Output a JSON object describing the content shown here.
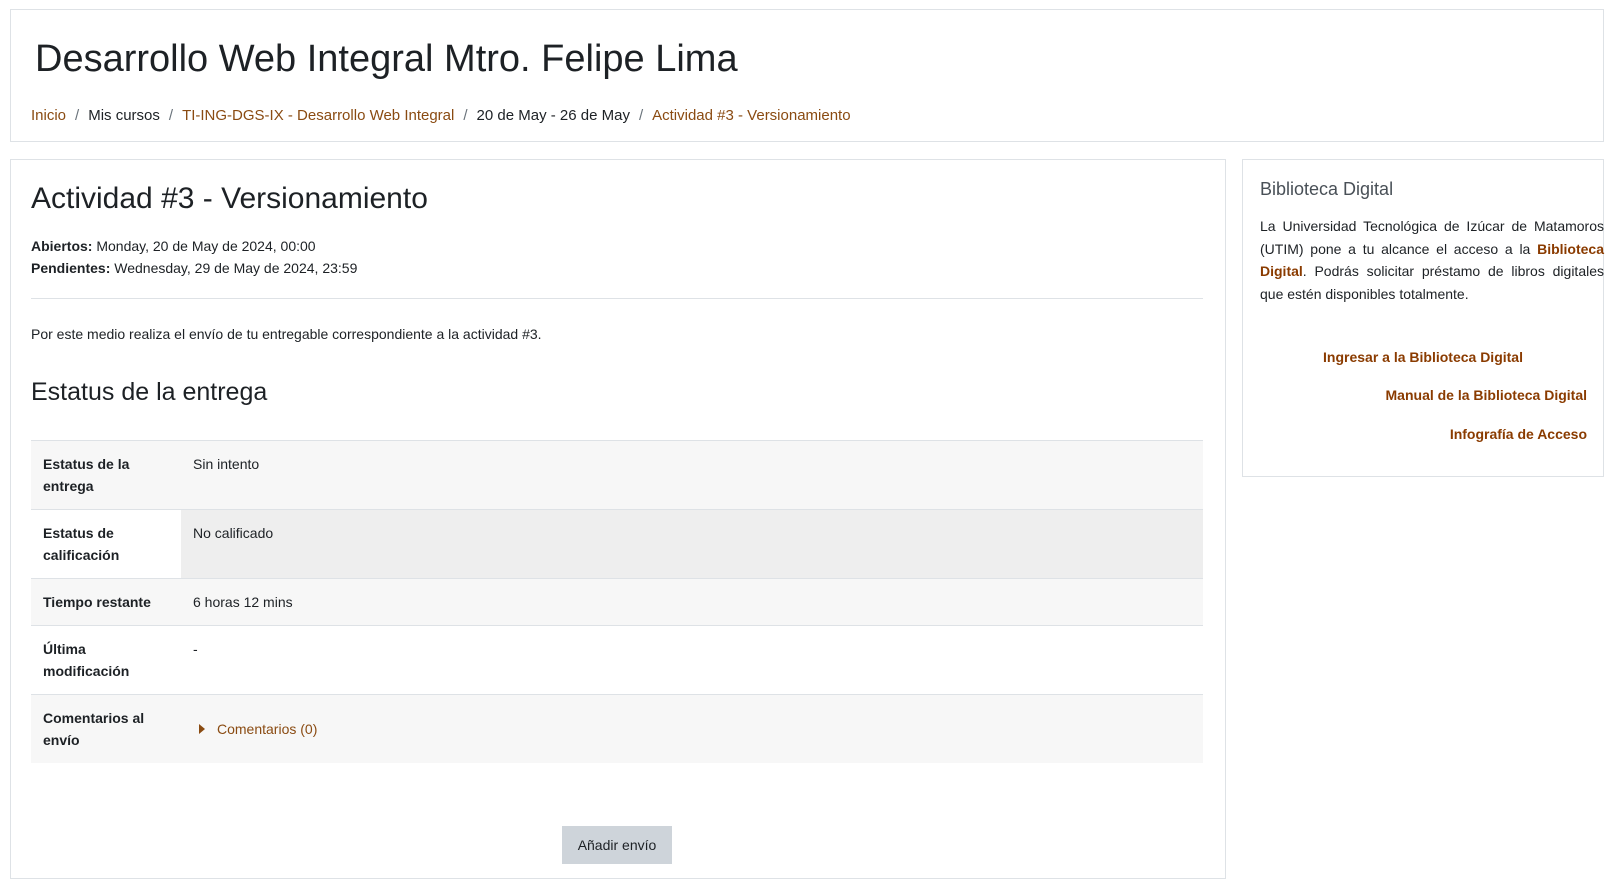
{
  "header": {
    "course_title": "Desarrollo Web Integral Mtro. Felipe Lima",
    "breadcrumb": [
      {
        "label": "Inicio",
        "link": true
      },
      {
        "label": "Mis cursos",
        "link": false
      },
      {
        "label": "TI-ING-DGS-IX - Desarrollo Web Integral",
        "link": true
      },
      {
        "label": "20 de May - 26 de May",
        "link": false
      },
      {
        "label": "Actividad #3 - Versionamiento",
        "link": true
      }
    ],
    "separator": "/"
  },
  "activity": {
    "title": "Actividad #3 - Versionamiento",
    "opened_label": "Abiertos:",
    "opened_value": "Monday, 20 de May de 2024, 00:00",
    "due_label": "Pendientes:",
    "due_value": "Wednesday, 29 de May de 2024, 23:59",
    "intro": "Por este medio realiza el envío de tu entregable correspondiente a la actividad #3."
  },
  "submission_status": {
    "section_title": "Estatus de la entrega",
    "rows": [
      {
        "label": "Estatus de la entrega",
        "value": "Sin intento"
      },
      {
        "label": "Estatus de calificación",
        "value": "No calificado"
      },
      {
        "label": "Tiempo restante",
        "value": "6 horas 12 mins"
      },
      {
        "label": "Última modificación",
        "value": "-"
      },
      {
        "label": "Comentarios al envío",
        "value": "Comentarios (0)"
      }
    ],
    "add_button": "Añadir envío"
  },
  "library_block": {
    "title": "Biblioteca Digital",
    "text_before": "La Universidad Tecnológica de Izúcar de Matamoros (UTIM) pone a tu alcance el acceso a la ",
    "text_link": "Biblioteca Digital",
    "text_after": ". Podrás solicitar préstamo de libros digitales que estén disponibles totalmente.",
    "links": [
      "Ingresar a la Biblioteca Digital",
      "Manual de la Biblioteca Digital",
      "Infografía de Acceso"
    ]
  },
  "colors": {
    "link": "#8a4b12",
    "block_link": "#8a3b00",
    "button_bg": "#ced4da",
    "border": "#dee2e6"
  }
}
